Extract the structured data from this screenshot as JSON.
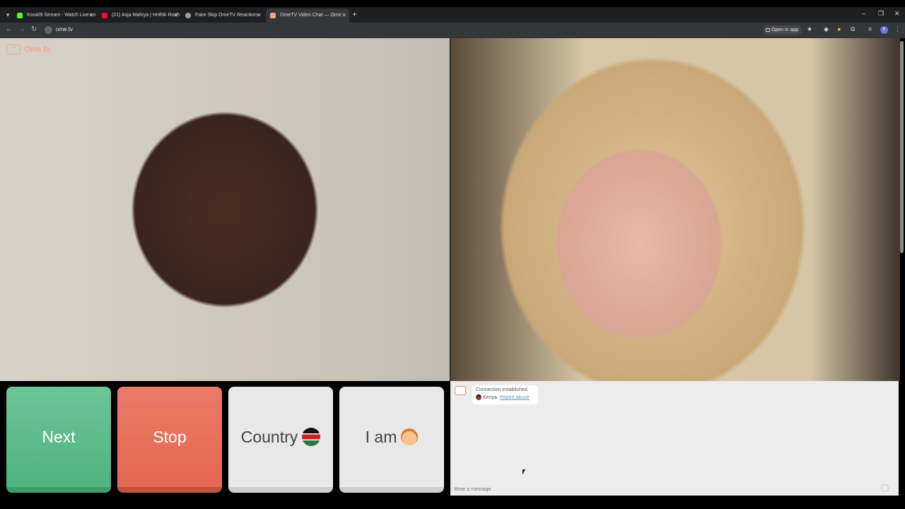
{
  "browser": {
    "tabs": [
      {
        "title": "Kora09 Stream - Watch Live on",
        "favicon_color": "#53fc18"
      },
      {
        "title": "(21) Asja Mahiya | Hrithik Rosh",
        "favicon_color": "#ff0033"
      },
      {
        "title": "Fake Skip OmeTV Reactions",
        "favicon_color": "#9aa0a6"
      },
      {
        "title": "OmeTV Video Chat — Ome",
        "favicon_color": "#f4a394"
      }
    ],
    "url": "ome.tv",
    "open_in_app": "Open in app",
    "profile_initial": "K"
  },
  "site": {
    "logo": "Ome.tv"
  },
  "controls": {
    "next_label": "Next",
    "stop_label": "Stop",
    "country_label": "Country",
    "iam_label": "I am"
  },
  "chat": {
    "message_line1": "Connection established.",
    "country": "Kenya.",
    "report_link": "Report abuse",
    "input_placeholder": "Write a message"
  },
  "colors": {
    "next": "#5bbb87",
    "stop": "#e76f58",
    "accent": "#f4a394"
  }
}
